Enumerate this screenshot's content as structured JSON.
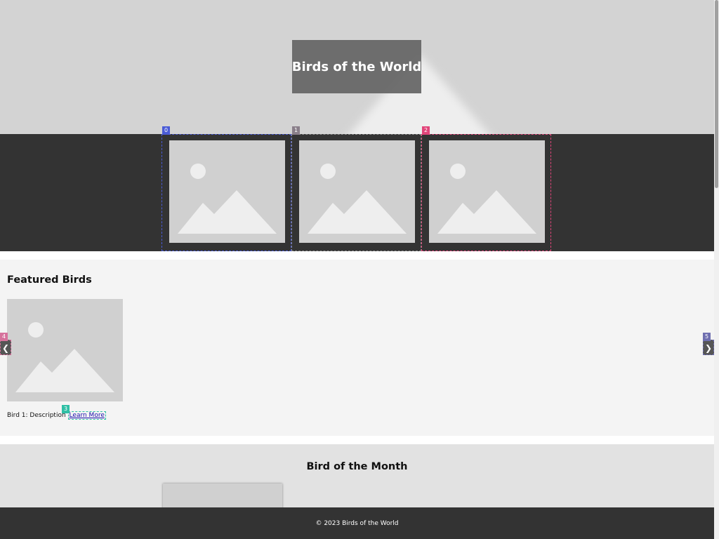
{
  "hero": {
    "title": "Birds of the World",
    "background_image": "mountain-placeholder"
  },
  "gallery": {
    "items": [
      {
        "badge": "0",
        "icon": "image-placeholder-icon",
        "highlight_color": "#4a5bd6"
      },
      {
        "badge": "1",
        "icon": "image-placeholder-icon",
        "highlight_color": "#888888"
      },
      {
        "badge": "2",
        "icon": "image-placeholder-icon",
        "highlight_color": "#e2457a"
      }
    ]
  },
  "featured": {
    "title": "Featured Birds",
    "items": [
      {
        "caption": "Bird 1: Description",
        "link_label": "Learn More",
        "link_badge": "3",
        "icon": "image-placeholder-icon"
      }
    ],
    "prev_arrow": {
      "label": "❮",
      "badge": "4"
    },
    "next_arrow": {
      "label": "❯",
      "badge": "5"
    }
  },
  "bird_of_month": {
    "title": "Bird of the Month"
  },
  "footer": {
    "text": "© 2023 Birds of the World"
  },
  "colors": {
    "hero_bg": "#d3d3d3",
    "dark_strip": "#333333",
    "placeholder": "#d0d0d0",
    "placeholder_shape": "#eeeeee",
    "badge_0": "#4a5bd6",
    "badge_1": "#8a7f8a",
    "badge_2": "#e2457a",
    "badge_3": "#2fbfa5",
    "badge_4": "#d6729c",
    "badge_5": "#6f6fb0",
    "link": "#1a0dab"
  }
}
